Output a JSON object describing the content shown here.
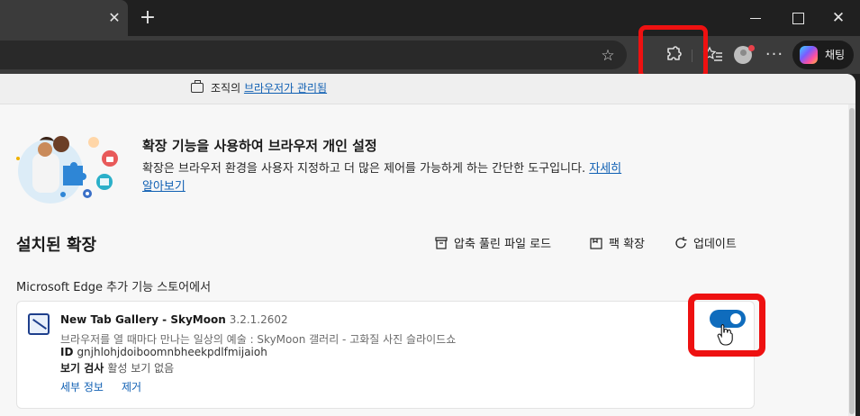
{
  "titlebar": {
    "close_tab_glyph": "✕",
    "new_tab_glyph": "+",
    "close_window_glyph": "✕"
  },
  "toolbar": {
    "star_glyph": "☆",
    "extensions_glyph": "⚙",
    "favorites_glyph": "☆≡",
    "more_glyph": "···",
    "chat_label": "채팅"
  },
  "managed": {
    "prefix": "조직의 ",
    "link": "브라우저가 관리됨"
  },
  "banner": {
    "title": "확장 기능을 사용하여 브라우저 개인 설정",
    "desc": "확장은 브라우저 환경을 사용자 지정하고 더 많은 제어를 가능하게 하는 간단한 도구입니다. ",
    "learn_more": "자세히 알아보기"
  },
  "installed": {
    "title": "설치된 확장",
    "load_unpacked": "압축 풀린 파일 로드",
    "pack": "팩 확장",
    "update": "업데이트"
  },
  "store_section": {
    "label": "Microsoft Edge 추가 기능 스토어에서"
  },
  "extension": {
    "name": "New Tab Gallery - SkyMoon",
    "version": "3.2.1.2602",
    "description": "브라우저를 열 때마다 만나는 일상의 예술 : SkyMoon 갤러리 - 고화질 사진 슬라이드쇼",
    "id_label": "ID",
    "id_value": "gnjhlohjdoiboomnbheekpdlfmijaioh",
    "inspect_label": "보기 검사",
    "inspect_value": "활성 보기 없음",
    "details": "세부 정보",
    "remove": "제거",
    "enabled": true
  },
  "colors": {
    "highlight": "#ee1111",
    "accent": "#0f6cbd",
    "link": "#0f5fb3"
  }
}
